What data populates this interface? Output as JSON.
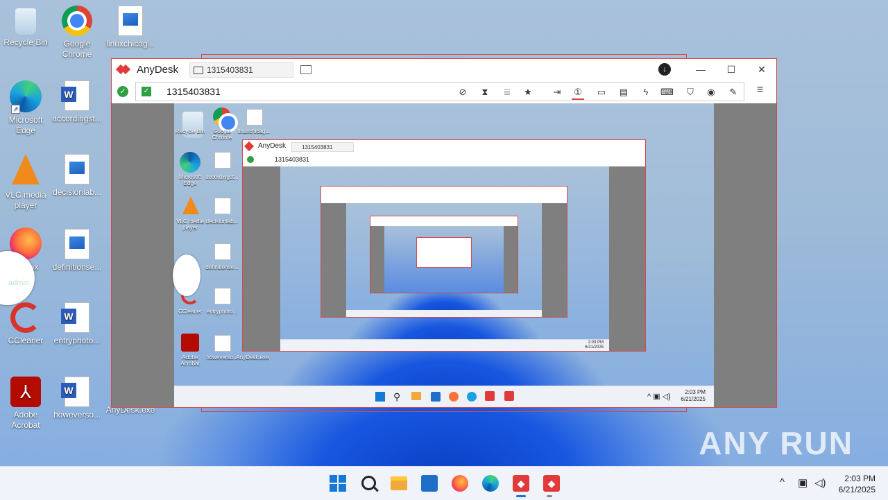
{
  "desktop": {
    "icons": [
      {
        "label": "Recycle Bin",
        "icon": "recycle-bin-icon"
      },
      {
        "label": "Google Chrome",
        "icon": "chrome-icon"
      },
      {
        "label": "linuxchicag...",
        "icon": "image-file-icon"
      },
      {
        "label": "Microsoft Edge",
        "icon": "edge-icon"
      },
      {
        "label": "accordingst...",
        "icon": "word-doc-icon"
      },
      {
        "label": "VLC media player",
        "icon": "vlc-icon"
      },
      {
        "label": "decisionlab...",
        "icon": "image-file-icon"
      },
      {
        "label": "Firefox",
        "icon": "firefox-icon"
      },
      {
        "label": "definitionse...",
        "icon": "image-file-icon"
      },
      {
        "label": "CCleaner",
        "icon": "ccleaner-icon"
      },
      {
        "label": "entryphoto...",
        "icon": "word-doc-icon"
      },
      {
        "label": "Adobe Acrobat",
        "icon": "acrobat-icon"
      },
      {
        "label": "howeverso...",
        "icon": "word-doc-icon"
      },
      {
        "label": "AnyDesk.exe",
        "icon": "anydesk-icon"
      }
    ],
    "cursor_text": "admin"
  },
  "anydesk": {
    "app_title": "AnyDesk",
    "tab_label": "1315403831",
    "address_value": "1315403831",
    "window_buttons": {
      "minimize": "—",
      "maximize": "☐",
      "close": "✕"
    },
    "toolbar_icons": [
      "privacy-icon",
      "hourglass-icon",
      "database-icon",
      "star-icon",
      "file-transfer-icon",
      "monitor-1-icon",
      "display-icon",
      "chat-icon",
      "lightning-icon",
      "keyboard-icon",
      "shield-icon",
      "record-icon",
      "pen-icon"
    ],
    "menu_icon": "≡"
  },
  "remote": {
    "icons": [
      {
        "label": "Recycle Bin"
      },
      {
        "label": "Google Chrome"
      },
      {
        "label": "linuxchicag..."
      },
      {
        "label": "Microsoft Edge"
      },
      {
        "label": "accordingst..."
      },
      {
        "label": "VLC media player"
      },
      {
        "label": "decisionlab..."
      },
      {
        "label": "definitionse..."
      },
      {
        "label": "CCleaner"
      },
      {
        "label": "entryphoto..."
      },
      {
        "label": "Adobe Acrobat"
      },
      {
        "label": "howeverso..."
      },
      {
        "label": "AnyDesk.exe"
      }
    ],
    "clock_time": "2:03 PM",
    "clock_date": "6/21/2025",
    "nested_tab_label": "1315403831",
    "nested_address": "1315403831",
    "nested_clock_time": "2:03 PM",
    "nested_clock_date": "6/21/2025"
  },
  "taskbar": {
    "clock_time": "2:03 PM",
    "clock_date": "6/21/2025",
    "tray_chevron": "^"
  },
  "watermark": "ANY RUN"
}
